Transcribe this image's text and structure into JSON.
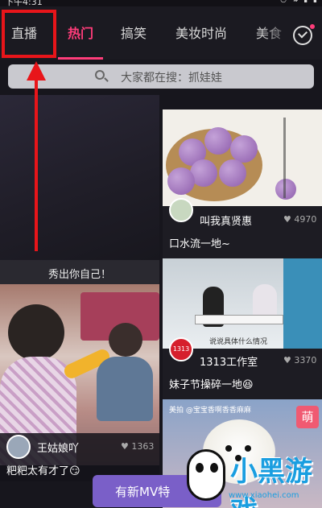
{
  "status": {
    "time": "下午4:31",
    "icons": "◷ ⇅ ▮ ▮"
  },
  "tabs": {
    "items": [
      {
        "label": "直播"
      },
      {
        "label": "热门"
      },
      {
        "label": "搞笑"
      },
      {
        "label": "美妆时尚"
      },
      {
        "label": "美食"
      }
    ],
    "active": "热门",
    "check_icon": "check-circle-icon"
  },
  "annotation": {
    "color": "#e8151a",
    "target": "直播"
  },
  "search": {
    "placeholder": "大家都在搜：抓娃娃"
  },
  "feed": {
    "left_header": "秀出你自己！",
    "left_card": {
      "user": "王姑娘吖",
      "likes": "1363",
      "desc": "粑粑太有才了😏"
    },
    "right_cards": [
      {
        "user": "叫我真贤惠",
        "likes": "4970",
        "desc": "口水流一地~"
      },
      {
        "user": "1313工作室",
        "likes": "3370",
        "desc": "妹子节操碎一地😆",
        "caption": "说说具体什么情况",
        "avatar_text": "1313"
      },
      {
        "top_caption": "美拍 @宝宝香啊香香麻麻",
        "tag": "萌"
      }
    ]
  },
  "banner": {
    "label": "有新MV特"
  },
  "watermark": {
    "brand": "小黑游戏",
    "url": "www.xiaohei.com"
  },
  "colors": {
    "accent": "#ff3d7a",
    "background": "#17161d"
  }
}
